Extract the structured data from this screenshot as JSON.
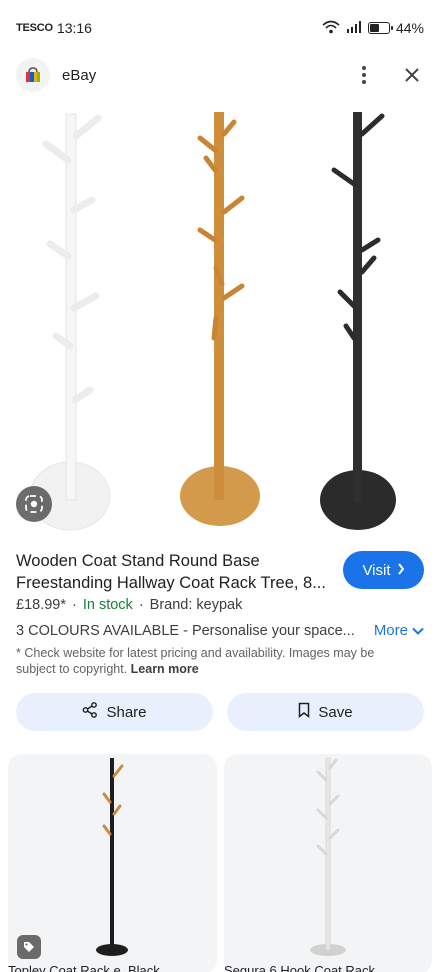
{
  "status_bar": {
    "carrier": "TESCO",
    "time": "13:16",
    "battery": "44%",
    "battery_level": 0.44
  },
  "header": {
    "site_name": "eBay",
    "icons": [
      "ebay-bag-icon",
      "more-vertical-icon",
      "close-icon"
    ]
  },
  "product": {
    "title_line1": "Wooden Coat Stand Round Base",
    "title_line2": "Freestanding Hallway Coat Rack Tree, 8...",
    "visit_label": "Visit",
    "price": "£18.99*",
    "separator": "·",
    "stock": "In stock",
    "brand": "Brand: keypak",
    "description": "3 COLOURS AVAILABLE - Personalise your space...",
    "more_label": "More",
    "disclaimer": "* Check website for latest pricing and availability. Images may be subject to copyright.",
    "learn_more": "Learn more",
    "share_label": "Share",
    "save_label": "Save",
    "image_colors": [
      "#f2f2f2",
      "#d39a4b",
      "#2b2b2b"
    ]
  },
  "related": [
    {
      "caption": "Topley Coat Rack e. Black"
    },
    {
      "caption": "Segura 6 Hook Coat Rack"
    }
  ],
  "colors": {
    "accent": "#1a73e8",
    "in_stock": "#188038",
    "button_bg": "#e8f0fe"
  }
}
